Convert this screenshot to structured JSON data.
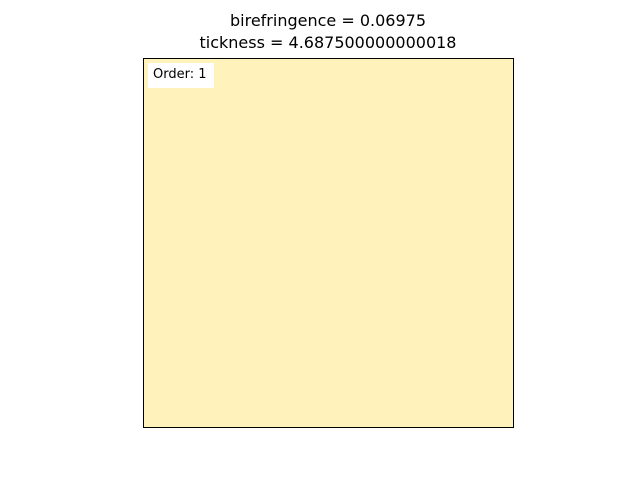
{
  "chart_data": {
    "type": "heatmap",
    "title_lines": [
      "birefringence = 0.06975",
      "tickness = 4.687500000000018"
    ],
    "annotation": "Order: 1",
    "fill_color": "#fff3bb",
    "frame_color": "#000000",
    "axes_ticks": false,
    "grid": false
  }
}
